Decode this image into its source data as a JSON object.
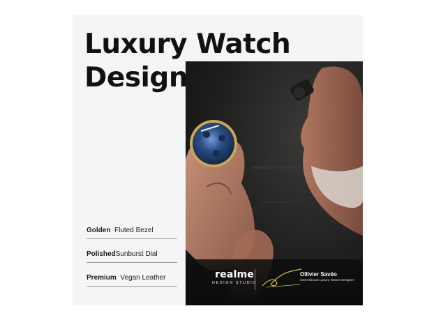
{
  "title": {
    "line1": "Luxury Watch",
    "line2": "Design"
  },
  "features": [
    {
      "bold": "Golden",
      "text": "Fluted Bezel"
    },
    {
      "bold": "Polished",
      "text": "Sunburst Dial"
    },
    {
      "bold": "Premium",
      "text": "Vegan Leather"
    }
  ],
  "brand": {
    "name": "realme",
    "subtitle": "DESIGN STUDIO"
  },
  "designer": {
    "name": "Ollivier Savéo",
    "title": "International Luxury Watch Designer"
  },
  "colors": {
    "background": "#f4f5f6",
    "title": "#111111",
    "photo_bg": "#1e1e1d",
    "watch_dial": "#2b4f86",
    "watch_bezel": "#c9a75a",
    "signature": "#d4b94a"
  }
}
